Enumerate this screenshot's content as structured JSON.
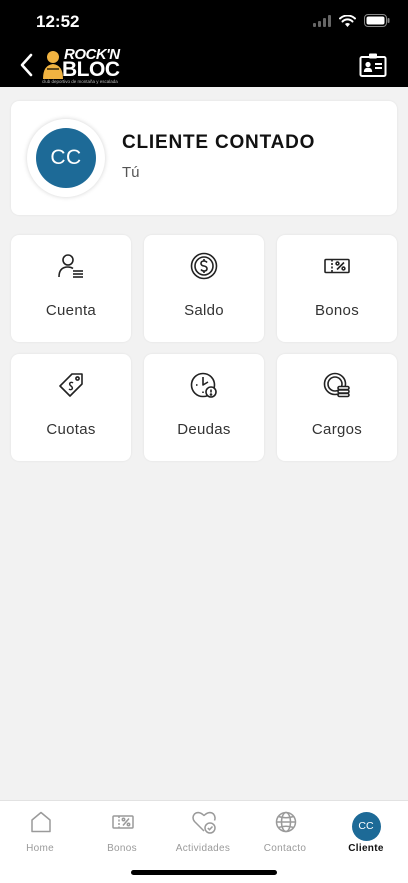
{
  "status": {
    "time": "12:52"
  },
  "header": {
    "logo_line1": "ROCK'N",
    "logo_line2": "BLOC",
    "logo_tagline": "club deportivo de montaña y escalada"
  },
  "profile": {
    "initials": "CC",
    "name": "CLIENTE CONTADO",
    "subtitle": "Tú"
  },
  "tiles": [
    {
      "label": "Cuenta",
      "icon": "user-list-icon"
    },
    {
      "label": "Saldo",
      "icon": "dollar-coin-icon"
    },
    {
      "label": "Bonos",
      "icon": "percent-ticket-icon"
    },
    {
      "label": "Cuotas",
      "icon": "price-tag-icon"
    },
    {
      "label": "Deudas",
      "icon": "clock-alert-icon"
    },
    {
      "label": "Cargos",
      "icon": "coins-icon"
    }
  ],
  "tabbar": {
    "items": [
      {
        "label": "Home",
        "icon": "home-icon",
        "active": false
      },
      {
        "label": "Bonos",
        "icon": "ticket-icon",
        "active": false
      },
      {
        "label": "Actividades",
        "icon": "heart-check-icon",
        "active": false
      },
      {
        "label": "Contacto",
        "icon": "globe-icon",
        "active": false
      },
      {
        "label": "Cliente",
        "icon": "avatar",
        "active": true
      }
    ],
    "avatar_initials": "CC"
  },
  "colors": {
    "accent": "#1d6a97",
    "header_bg": "#000000",
    "page_bg": "#f2f2f2"
  }
}
